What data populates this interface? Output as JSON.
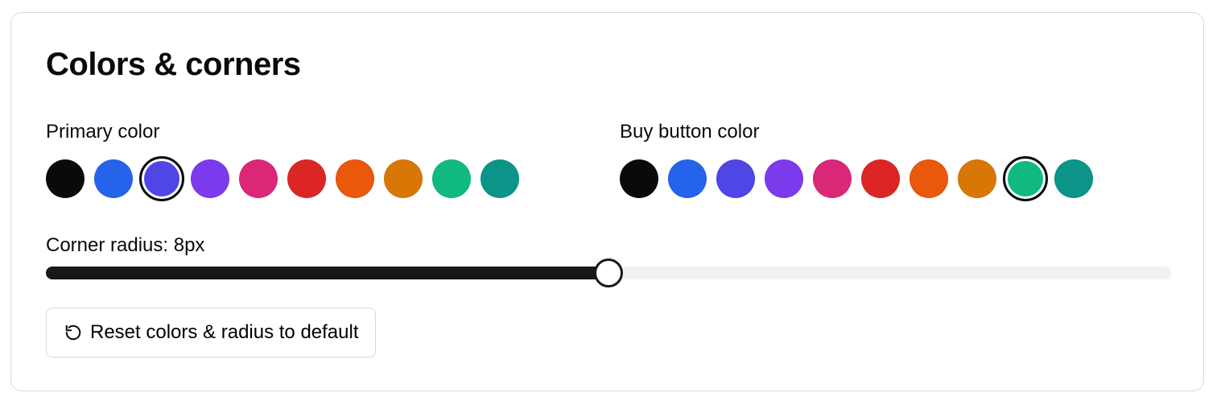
{
  "section": {
    "title": "Colors & corners"
  },
  "primary": {
    "label": "Primary color",
    "selected_index": 2,
    "colors": [
      "#0a0a0a",
      "#2563eb",
      "#4f46e5",
      "#7c3aed",
      "#db2777",
      "#dc2626",
      "#ea580c",
      "#d97706",
      "#10b981",
      "#0d9488"
    ]
  },
  "buy": {
    "label": "Buy button color",
    "selected_index": 8,
    "colors": [
      "#0a0a0a",
      "#2563eb",
      "#4f46e5",
      "#7c3aed",
      "#db2777",
      "#dc2626",
      "#ea580c",
      "#d97706",
      "#10b981",
      "#0d9488"
    ]
  },
  "radius": {
    "label": "Corner radius: 8px",
    "value_fraction": 0.5
  },
  "reset": {
    "label": "Reset colors & radius to default",
    "icon": "reset-icon"
  }
}
